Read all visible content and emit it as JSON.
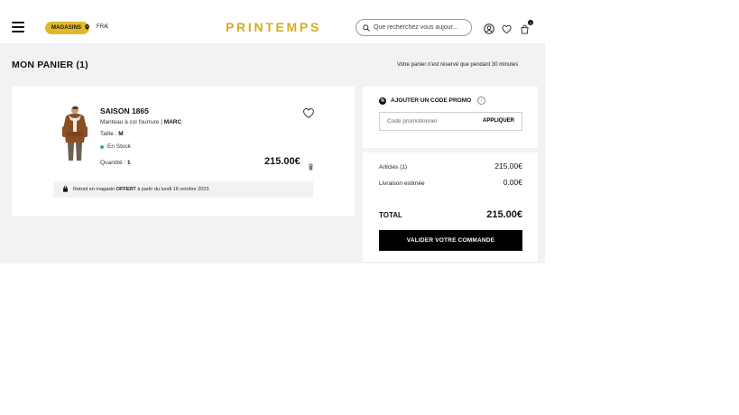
{
  "header": {
    "stores_label": "MAGASINS",
    "locale": "FR/€",
    "logo": "PRINTEMPS",
    "search_placeholder": "Que recherchez vous aujour...",
    "cart_count": "1"
  },
  "page": {
    "title": "MON PANIER (1)",
    "reserve_note": "Votre panier n'est réservé que pendant 30 minutes"
  },
  "cart": {
    "items": [
      {
        "brand": "SAISON 1865",
        "description": "Manteau à col fourrure | ",
        "description_strong": "MARC",
        "size_label": "Taille : ",
        "size_value": "M",
        "stock": "En Stock",
        "quantity_label": "Quantité : ",
        "quantity_value": "1",
        "price": "215.00€"
      }
    ],
    "pickup_prefix": "Retrait en magasin ",
    "pickup_strong": "OFFERT",
    "pickup_suffix": " à partir du lundi 16 octobre 2023"
  },
  "promo": {
    "title": "AJOUTER UN CODE PROMO",
    "placeholder": "Code promotionnel",
    "apply_label": "APPLIQUER"
  },
  "summary": {
    "articles_label": "Articles (1)",
    "articles_value": "215.00€",
    "delivery_label": "Livraison estimée",
    "delivery_value": "0.00€",
    "total_label": "TOTAL",
    "total_value": "215.00€",
    "checkout_label": "VALIDER VOTRE COMMANDE"
  },
  "colors": {
    "brand_gold": "#d6ad1e",
    "pill_gold": "#e0b92a",
    "stock_green": "#2bb673",
    "checkout_bg": "#000000"
  },
  "icons": [
    "menu-icon",
    "location-pin-icon",
    "search-icon",
    "account-icon",
    "heart-icon",
    "cart-icon",
    "trash-icon",
    "store-icon",
    "percent-icon",
    "info-icon"
  ]
}
